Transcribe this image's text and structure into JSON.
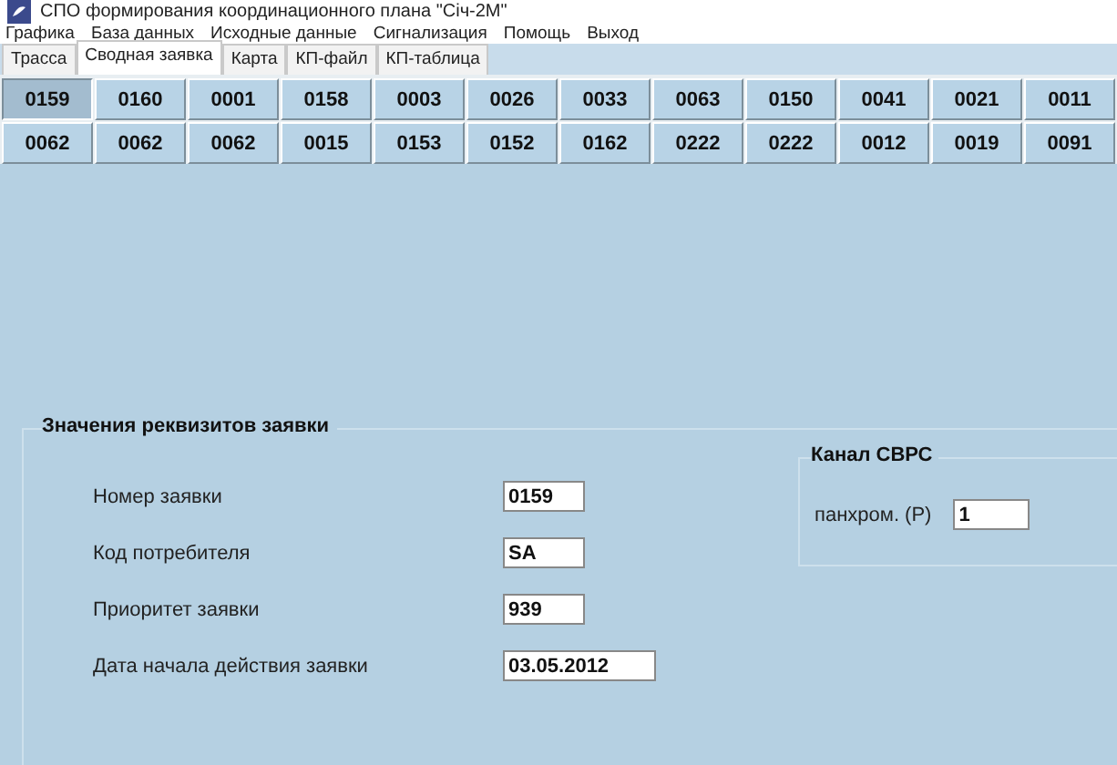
{
  "window": {
    "title": "СПО формирования координационного плана \"Січ-2М\""
  },
  "menu": [
    "Графика",
    "База данных",
    "Исходные данные",
    "Сигнализация",
    "Помощь",
    "Выход"
  ],
  "tabs": [
    {
      "label": "Трасса",
      "selected": false
    },
    {
      "label": "Сводная заявка",
      "selected": true
    },
    {
      "label": "Карта",
      "selected": false
    },
    {
      "label": "КП-файл",
      "selected": false
    },
    {
      "label": "КП-таблица",
      "selected": false
    }
  ],
  "request_buttons": [
    [
      {
        "label": "0159",
        "selected": true
      },
      {
        "label": "0160",
        "selected": false
      },
      {
        "label": "0001",
        "selected": false
      },
      {
        "label": "0158",
        "selected": false
      },
      {
        "label": "0003",
        "selected": false
      },
      {
        "label": "0026",
        "selected": false
      },
      {
        "label": "0033",
        "selected": false
      },
      {
        "label": "0063",
        "selected": false
      },
      {
        "label": "0150",
        "selected": false
      },
      {
        "label": "0041",
        "selected": false
      },
      {
        "label": "0021",
        "selected": false
      },
      {
        "label": "0011",
        "selected": false
      }
    ],
    [
      {
        "label": "0062",
        "selected": false
      },
      {
        "label": "0062",
        "selected": false
      },
      {
        "label": "0062",
        "selected": false
      },
      {
        "label": "0015",
        "selected": false
      },
      {
        "label": "0153",
        "selected": false
      },
      {
        "label": "0152",
        "selected": false
      },
      {
        "label": "0162",
        "selected": false
      },
      {
        "label": "0222",
        "selected": false
      },
      {
        "label": "0222",
        "selected": false
      },
      {
        "label": "0012",
        "selected": false
      },
      {
        "label": "0019",
        "selected": false
      },
      {
        "label": "0091",
        "selected": false
      }
    ]
  ],
  "request_group": {
    "title": "Значения реквизитов заявки",
    "fields": [
      {
        "label": "Номер заявки",
        "value": "0159"
      },
      {
        "label": "Код потребителя",
        "value": "SA"
      },
      {
        "label": "Приоритет заявки",
        "value": "939"
      },
      {
        "label": "Дата начала действия заявки",
        "value": "03.05.2012"
      }
    ]
  },
  "channel_group": {
    "title": "Канал СВРС",
    "label": "панхром. (Р)",
    "value": "1"
  }
}
